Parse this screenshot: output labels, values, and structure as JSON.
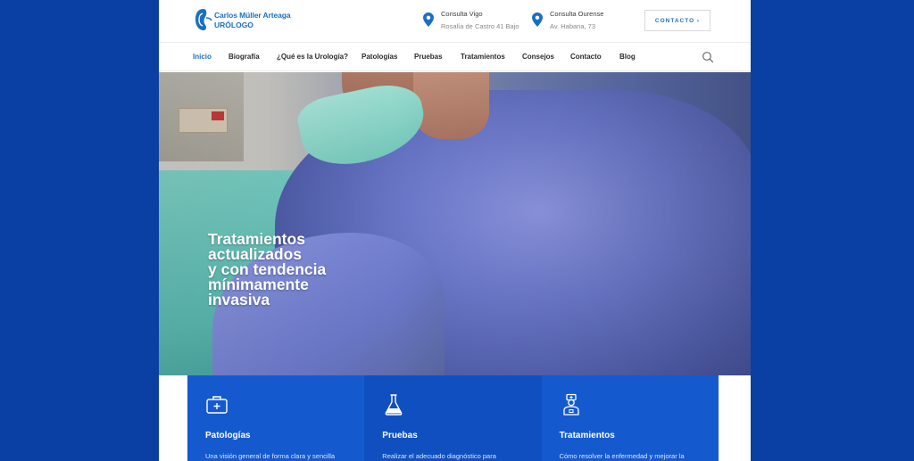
{
  "brand": {
    "name": "Carlos Müller Arteaga",
    "subtitle": "URÓLOGO",
    "colors": {
      "accent": "#1b6fc2",
      "page_bg": "#0a3fa3",
      "card": "#1559cf"
    }
  },
  "header": {
    "locations": [
      {
        "title": "Consulta Vigo",
        "address": "Rosalía de Castro 41 Bajo",
        "icon": "map-pin-icon"
      },
      {
        "title": "Consulta Ourense",
        "address": "Av. Habana, 73",
        "icon": "map-pin-icon"
      }
    ],
    "contact_button": "CONTACTO  ›"
  },
  "nav": {
    "items": [
      {
        "label": "Inicio",
        "active": true
      },
      {
        "label": "Biografía"
      },
      {
        "label": "¿Qué es la Urología?"
      },
      {
        "label": "Patologías"
      },
      {
        "label": "Pruebas"
      },
      {
        "label": "Tratamientos"
      },
      {
        "label": "Consejos"
      },
      {
        "label": "Contacto"
      },
      {
        "label": "Blog"
      }
    ],
    "search_icon": "search-icon"
  },
  "hero": {
    "lines": [
      "Tratamientos",
      "actualizados",
      "y con tendencia",
      "mínimamente",
      "invasiva"
    ]
  },
  "cards": [
    {
      "icon": "medical-kit-icon",
      "title": "Patologías",
      "desc": "Una visión general de forma clara y sencilla"
    },
    {
      "icon": "flask-icon",
      "title": "Pruebas",
      "desc": "Realizar el adecuado diagnóstico para"
    },
    {
      "icon": "doctor-icon",
      "title": "Tratamientos",
      "desc": "Cómo resolver la enfermedad y mejorar la"
    }
  ]
}
